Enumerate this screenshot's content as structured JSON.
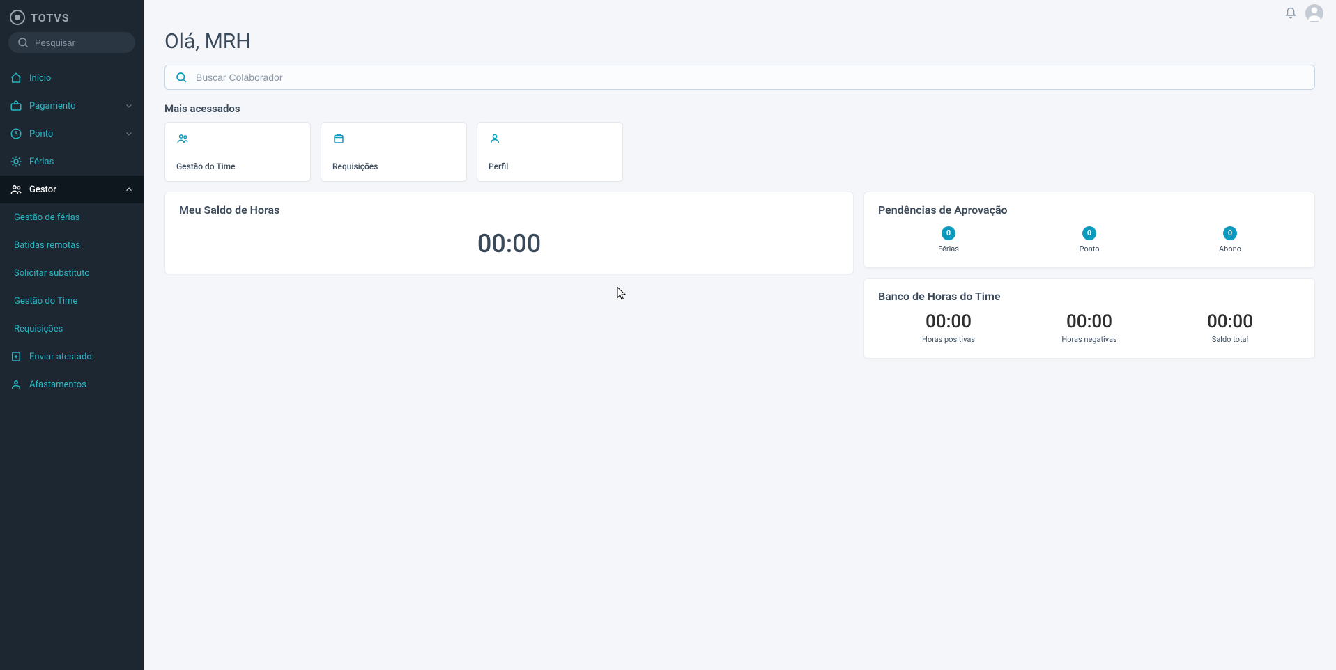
{
  "brand": {
    "name": "TOTVS"
  },
  "sidebar": {
    "search_placeholder": "Pesquisar",
    "items": [
      {
        "key": "inicio",
        "label": "Início",
        "icon": "home-icon",
        "expandable": false
      },
      {
        "key": "pagamento",
        "label": "Pagamento",
        "icon": "briefcase-icon",
        "expandable": true
      },
      {
        "key": "ponto",
        "label": "Ponto",
        "icon": "clock-icon",
        "expandable": true
      },
      {
        "key": "ferias",
        "label": "Férias",
        "icon": "sun-icon",
        "expandable": false
      },
      {
        "key": "gestor",
        "label": "Gestor",
        "icon": "people-icon",
        "expandable": true,
        "expanded": true,
        "children": [
          {
            "key": "gestao-ferias",
            "label": "Gestão de férias"
          },
          {
            "key": "batidas-remotas",
            "label": "Batidas remotas"
          },
          {
            "key": "solicitar-substituto",
            "label": "Solicitar substituto"
          },
          {
            "key": "gestao-time",
            "label": "Gestão do Time"
          },
          {
            "key": "requisicoes",
            "label": "Requisições"
          }
        ]
      },
      {
        "key": "enviar-atestado",
        "label": "Enviar atestado",
        "icon": "document-add-icon",
        "expandable": false
      },
      {
        "key": "afastamentos",
        "label": "Afastamentos",
        "icon": "person-off-icon",
        "expandable": false
      }
    ]
  },
  "header": {
    "greeting": "Olá, MRH",
    "search_placeholder": "Buscar Colaborador"
  },
  "quick": {
    "title": "Mais acessados",
    "cards": [
      {
        "icon": "team-icon",
        "label": "Gestão do Time"
      },
      {
        "icon": "inbox-icon",
        "label": "Requisições"
      },
      {
        "icon": "person-icon",
        "label": "Perfil"
      }
    ]
  },
  "saldo": {
    "title": "Meu Saldo de Horas",
    "value": "00:00"
  },
  "pendencias": {
    "title": "Pendências de Aprovação",
    "items": [
      {
        "count": "0",
        "label": "Férias"
      },
      {
        "count": "0",
        "label": "Ponto"
      },
      {
        "count": "0",
        "label": "Abono"
      }
    ]
  },
  "banco": {
    "title": "Banco de Horas do Time",
    "items": [
      {
        "value": "00:00",
        "label": "Horas positivas"
      },
      {
        "value": "00:00",
        "label": "Horas negativas"
      },
      {
        "value": "00:00",
        "label": "Saldo total"
      }
    ]
  },
  "colors": {
    "accent": "#0c9abe",
    "sidebar_bg": "#1d2731"
  }
}
